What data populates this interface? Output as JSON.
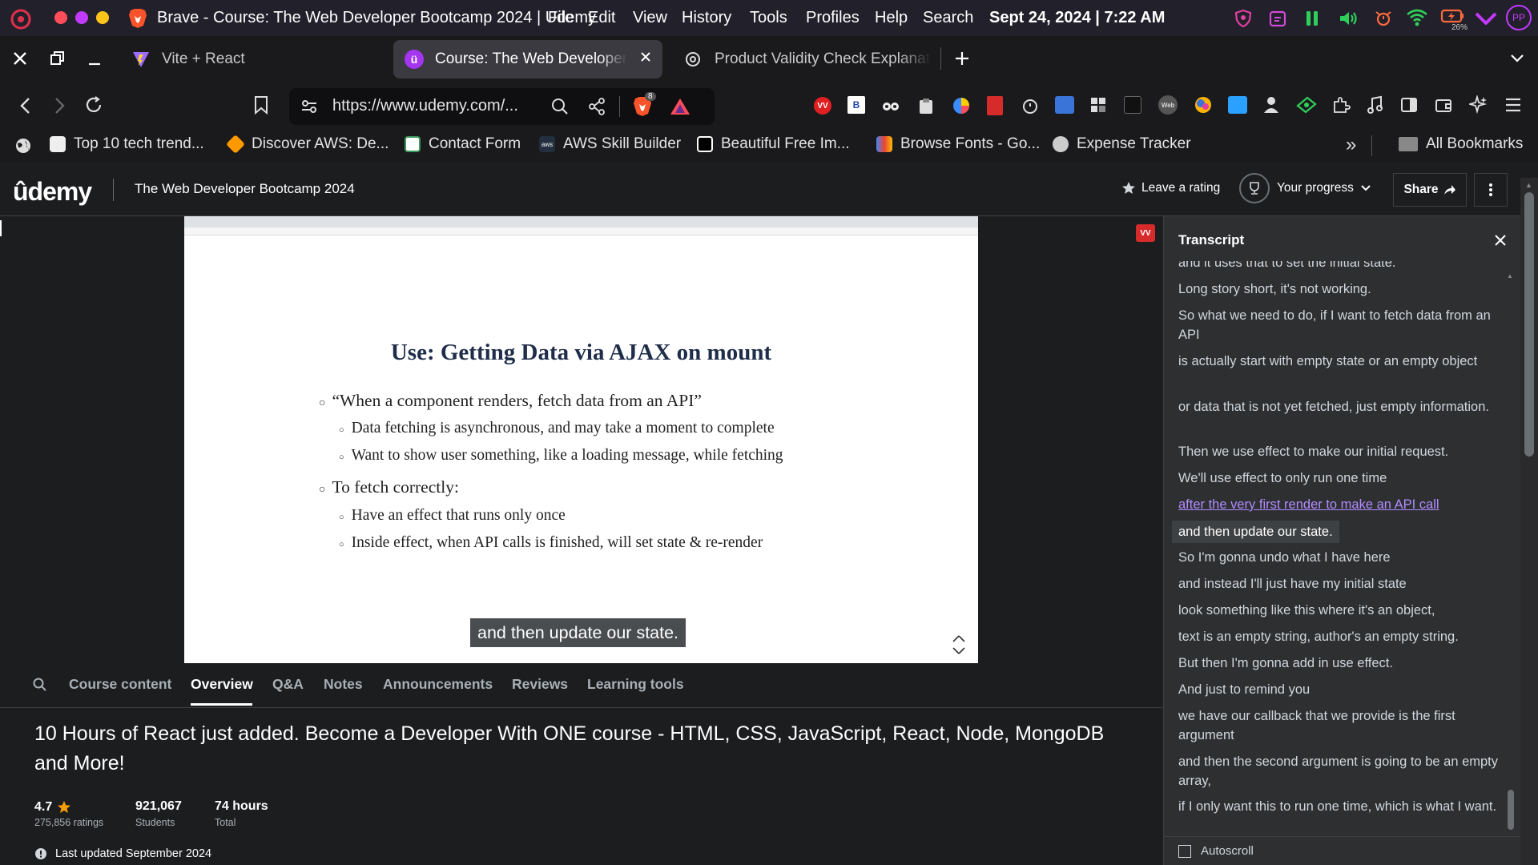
{
  "system_bar": {
    "app_title": "Brave - Course: The Web Developer Bootcamp 2024 | Udemy",
    "menus": [
      "File",
      "Edit",
      "View",
      "History",
      "Tools",
      "Profiles",
      "Help",
      "Search"
    ],
    "datetime": "Sept 24, 2024 | 7:22 AM",
    "battery": "26%",
    "profile_initials": "PP"
  },
  "tabs": [
    {
      "label": "Vite + React"
    },
    {
      "label": "Course: The Web Developer B"
    },
    {
      "label": "Product Validity Check Explanati"
    }
  ],
  "address_bar": {
    "url": "https://www.udemy.com/...",
    "shield_badge": "8"
  },
  "bookmarks": [
    {
      "label": "Top 10 tech trend..."
    },
    {
      "label": "Discover AWS: De..."
    },
    {
      "label": "Contact Form"
    },
    {
      "label": "AWS Skill Builder"
    },
    {
      "label": "Beautiful Free Im..."
    },
    {
      "label": "Browse Fonts - Go..."
    },
    {
      "label": "Expense Tracker"
    }
  ],
  "bookmarks_overflow": "»",
  "all_bookmarks": "All Bookmarks",
  "udemy": {
    "logo": "ûdemy",
    "course_title": "The Web Developer Bootcamp 2024",
    "leave_rating": "Leave a rating",
    "your_progress": "Your progress",
    "share": "Share"
  },
  "slide": {
    "title": "Use: Getting Data via AJAX on mount",
    "bullets": [
      {
        "level": 1,
        "text": "“When a component renders, fetch data from an API”"
      },
      {
        "level": 2,
        "text": "Data fetching is asynchronous, and may take a moment to complete"
      },
      {
        "level": 2,
        "text": "Want to show user something, like a loading message, while fetching"
      },
      {
        "level": 1,
        "text": "To fetch correctly:"
      },
      {
        "level": 2,
        "text": "Have an effect that runs only once"
      },
      {
        "level": 2,
        "text": "Inside effect, when API calls is finished, will set state & re-render"
      }
    ],
    "caption": "and then update our state."
  },
  "transcript": {
    "title": "Transcript",
    "lines": [
      {
        "text": "and it uses that to set the initial state.",
        "style": "normal"
      },
      {
        "text": "Long story short, it's not working.",
        "style": "normal"
      },
      {
        "text": "So what we need to do, if I want to fetch data from an API",
        "style": "normal"
      },
      {
        "text": "is actually start with empty state or an empty object",
        "style": "normal"
      },
      {
        "text": "or data that is not yet fetched, just empty information.",
        "style": "normal"
      },
      {
        "text": "Then we use effect to make our initial request.",
        "style": "normal"
      },
      {
        "text": "We'll use effect to only run one time",
        "style": "normal"
      },
      {
        "text": "after the very first render to make an API call",
        "style": "link"
      },
      {
        "text": "and then update our state.",
        "style": "current"
      },
      {
        "text": "So I'm gonna undo what I have here",
        "style": "normal"
      },
      {
        "text": "and instead I'll just have my initial state",
        "style": "normal"
      },
      {
        "text": "look something like this where it's an object,",
        "style": "normal"
      },
      {
        "text": "text is an empty string, author's an empty string.",
        "style": "normal"
      },
      {
        "text": "But then I'm gonna add in use effect.",
        "style": "normal"
      },
      {
        "text": "And just to remind you",
        "style": "normal"
      },
      {
        "text": "we have our callback that we provide is the first argument",
        "style": "normal"
      },
      {
        "text": "and then the second argument is going to be an empty array,",
        "style": "normal"
      },
      {
        "text": "if I only want this to run one time, which is what I want.",
        "style": "normal"
      }
    ],
    "autoscroll": "Autoscroll"
  },
  "course_tabs": [
    "Course content",
    "Overview",
    "Q&A",
    "Notes",
    "Announcements",
    "Reviews",
    "Learning tools"
  ],
  "active_course_tab": "Overview",
  "overview": {
    "headline": "10 Hours of React just added. Become a Developer With ONE course - HTML, CSS, JavaScript, React, Node, MongoDB and More!",
    "rating": "4.7",
    "ratings_count": "275,856 ratings",
    "students": "921,067",
    "students_label": "Students",
    "hours": "74 hours",
    "hours_label": "Total",
    "last_updated": "Last updated September 2024"
  },
  "colors": {
    "udemy_purple": "#a435f0",
    "brave_orange": "#fb542b",
    "star": "#f69c08"
  }
}
